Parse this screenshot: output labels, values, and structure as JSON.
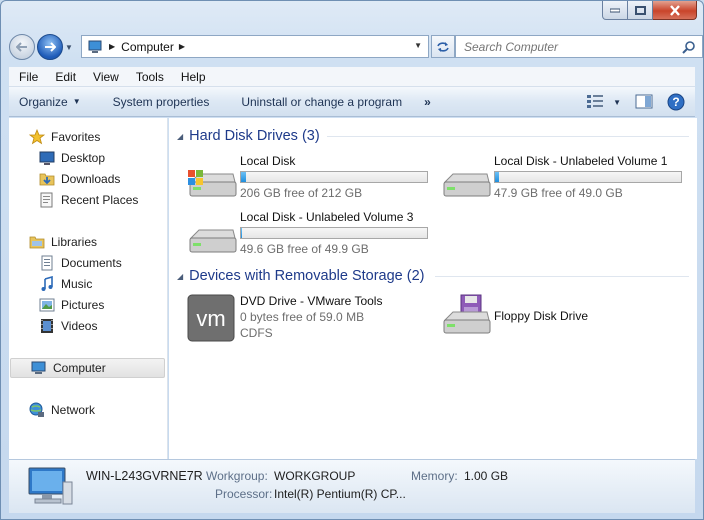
{
  "address": {
    "crumb": "Computer"
  },
  "search": {
    "placeholder": "Search Computer"
  },
  "menu": [
    "File",
    "Edit",
    "View",
    "Tools",
    "Help"
  ],
  "toolbar": {
    "organize": "Organize",
    "system_properties": "System properties",
    "uninstall": "Uninstall or change a program",
    "more": "»"
  },
  "sidebar": {
    "favorites": "Favorites",
    "desktop": "Desktop",
    "downloads": "Downloads",
    "recent_places": "Recent Places",
    "libraries": "Libraries",
    "documents": "Documents",
    "music": "Music",
    "pictures": "Pictures",
    "videos": "Videos",
    "computer": "Computer",
    "network": "Network"
  },
  "groups": {
    "hard_disks": "Hard Disk Drives (3)",
    "removable": "Devices with Removable Storage (2)"
  },
  "drives": [
    {
      "name": "Local Disk",
      "free": "206 GB free of 212 GB",
      "used_fraction": 0.028
    },
    {
      "name": "Local Disk - Unlabeled Volume 1",
      "free": "47.9 GB free of 49.0 GB",
      "used_fraction": 0.022
    },
    {
      "name": "Local Disk - Unlabeled Volume 3",
      "free": "49.6 GB free of 49.9 GB",
      "used_fraction": 0.006
    }
  ],
  "removable": [
    {
      "name": "DVD Drive - VMware Tools",
      "free": "0 bytes free of 59.0 MB",
      "fs": "CDFS",
      "logo": "vm"
    },
    {
      "name": "Floppy Disk Drive"
    }
  ],
  "details": {
    "computer_name": "WIN-L243GVRNE7R",
    "workgroup_label": "Workgroup:",
    "workgroup": "WORKGROUP",
    "memory_label": "Memory:",
    "memory": "1.00 GB",
    "processor_label": "Processor:",
    "processor": "Intel(R) Pentium(R) CP..."
  },
  "colors": {
    "accent": "#1e3a8a",
    "bar_fill": "#1f8fdd",
    "selection": "#e2e2e2"
  }
}
